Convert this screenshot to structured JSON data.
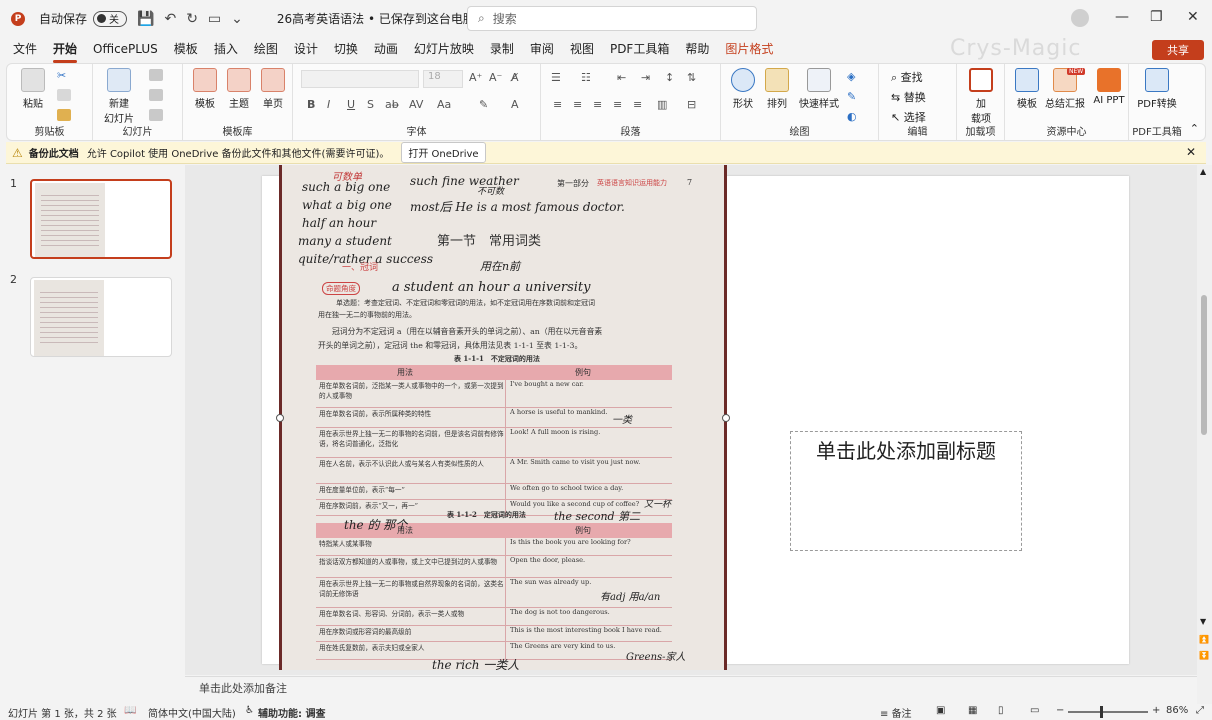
{
  "titlebar": {
    "app_letter": "P",
    "autosave_label": "自动保存",
    "autosave_state": "关",
    "document_title": "26高考英语语法 • 已保存到这台电脑",
    "search_placeholder": "搜索",
    "minimize": "—",
    "restore": "❐",
    "close": "✕"
  },
  "menu": {
    "tabs": [
      "文件",
      "开始",
      "OfficePLUS",
      "模板",
      "插入",
      "绘图",
      "设计",
      "切换",
      "动画",
      "幻灯片放映",
      "录制",
      "审阅",
      "视图",
      "PDF工具箱",
      "帮助",
      "图片格式"
    ],
    "active_index": 1,
    "special_index": 15,
    "watermark": "Crys-Magic",
    "share_label": "共享"
  },
  "ribbon": {
    "clipboard": {
      "paste": "粘贴",
      "group": "剪贴板"
    },
    "slides": {
      "new_slide_line1": "新建",
      "new_slide_line2": "幻灯片",
      "group": "幻灯片"
    },
    "template_lib": {
      "template": "模板",
      "theme": "主题",
      "single_page": "单页",
      "group": "模板库"
    },
    "font": {
      "font_size": "18",
      "bold": "B",
      "italic": "I",
      "underline": "U",
      "strike": "S",
      "group": "字体"
    },
    "paragraph": {
      "group": "段落"
    },
    "drawing": {
      "shape": "形状",
      "arrange": "排列",
      "quick_style": "快速样式",
      "group": "绘图"
    },
    "editing": {
      "find": "查找",
      "replace": "替换",
      "select": "选择",
      "group": "编辑"
    },
    "addins": {
      "label_line1": "加",
      "label_line2": "载项",
      "group": "加载项"
    },
    "resources": {
      "template": "模板",
      "summary": "总结汇报",
      "ai_ppt": "AI PPT",
      "new_badge": "NEW",
      "group": "资源中心"
    },
    "pdf": {
      "convert": "PDF转换",
      "group": "PDF工具箱"
    }
  },
  "notification": {
    "title": "备份此文档",
    "message": "允许 Copilot 使用 OneDrive 备份此文件和其他文件(需要许可证)。",
    "button": "打开 OneDrive"
  },
  "thumbnails": [
    {
      "number": "1",
      "selected": true
    },
    {
      "number": "2",
      "selected": false
    }
  ],
  "slide": {
    "subtitle_placeholder": "单击此处添加副标题",
    "photo": {
      "section_label": "第一部分",
      "section_sub": "英语语言知识运用能力",
      "page_num": "7",
      "heading": "第一节　常用词类",
      "sub_heading": "一、冠词",
      "exam_label": "命题角度",
      "intro_line1": "单选题：考查定冠词、不定冠词和零冠词的用法，如不定冠词用在序数词前和定冠词",
      "intro_line2": "用在独一无二的事物前的用法。",
      "body_line1": "冠词分为不定冠词 a（用在以辅音音素开头的单词之前）、an（用在以元音音素",
      "body_line2": "开头的单词之前），定冠词 the 和零冠词，具体用法见表 1-1-1 至表 1-1-3。",
      "table1_title": "表 1-1-1　不定冠词的用法",
      "table2_title": "表 1-1-2　定冠词的用法",
      "col_usage": "用法",
      "col_example": "例句",
      "table1_rows": [
        [
          "用在单数名词前，泛指某一类人或事物中的一个，或第一次提到的人或事物",
          "I've bought a new car."
        ],
        [
          "用在单数名词前，表示所属种类的特性",
          "A horse is useful to mankind."
        ],
        [
          "用在表示世界上独一无二的事物的名词前，但是该名词前有修饰语，将名词普通化，泛指化",
          "Look! A full moon is rising."
        ],
        [
          "用在人名前，表示不认识此人或与某名人有类似性质的人",
          "A Mr. Smith came to visit you just now."
        ],
        [
          "用在度量单位前，表示“每一”",
          "We often go to school twice a day."
        ],
        [
          "用在序数词前，表示“又一，再一”",
          "Would you like a second cup of coffee?"
        ]
      ],
      "table2_rows": [
        [
          "特指某人或某事物",
          "Is this the book you are looking for?"
        ],
        [
          "指谈话双方都知道的人或事物，或上文中已提到过的人或事物",
          "Open the door, please."
        ],
        [
          "用在表示世界上独一无二的事物或自然界现象的名词前，这类名词前无修饰语",
          "The sun was already up."
        ],
        [
          "用在单数名词、形容词、分词前，表示一类人或物",
          "The dog is not too dangerous."
        ],
        [
          "用在序数词或形容词的最高级前",
          "This is the most interesting book I have read."
        ],
        [
          "用在姓氏复数前，表示夫妇或全家人",
          "The Greens are very kind to us."
        ]
      ],
      "handwriting": {
        "h1": "such a big one",
        "h2": "what a big one",
        "h3": "half an hour",
        "h4": "many a student",
        "h5": "quite/rather a success",
        "h6": "such fine weather",
        "h7": "most后 He is a most famous doctor.",
        "h8": "用在n前",
        "h9": "a student    an hour    a university",
        "h10": "the 的 那个",
        "h11": "the second 第二",
        "h12": "the rich 一类人",
        "h13": "Greens-家人",
        "h14": "又一杯",
        "h15": "有adj 用a/an",
        "h16": "一类",
        "h17": "可数单",
        "h18": "不可数"
      }
    }
  },
  "notes": {
    "placeholder": "单击此处添加备注"
  },
  "statusbar": {
    "slide_info": "幻灯片 第 1 张，共 2 张",
    "language": "简体中文(中国大陆)",
    "accessibility": "辅助功能: 调查",
    "notes_btn": "备注",
    "zoom": "86%"
  },
  "colors": {
    "accent": "#c43e1c",
    "ribbon_bg": "#fbfbfb",
    "notify_bg": "#fdf6d8",
    "table_header": "#e7a9ad"
  }
}
